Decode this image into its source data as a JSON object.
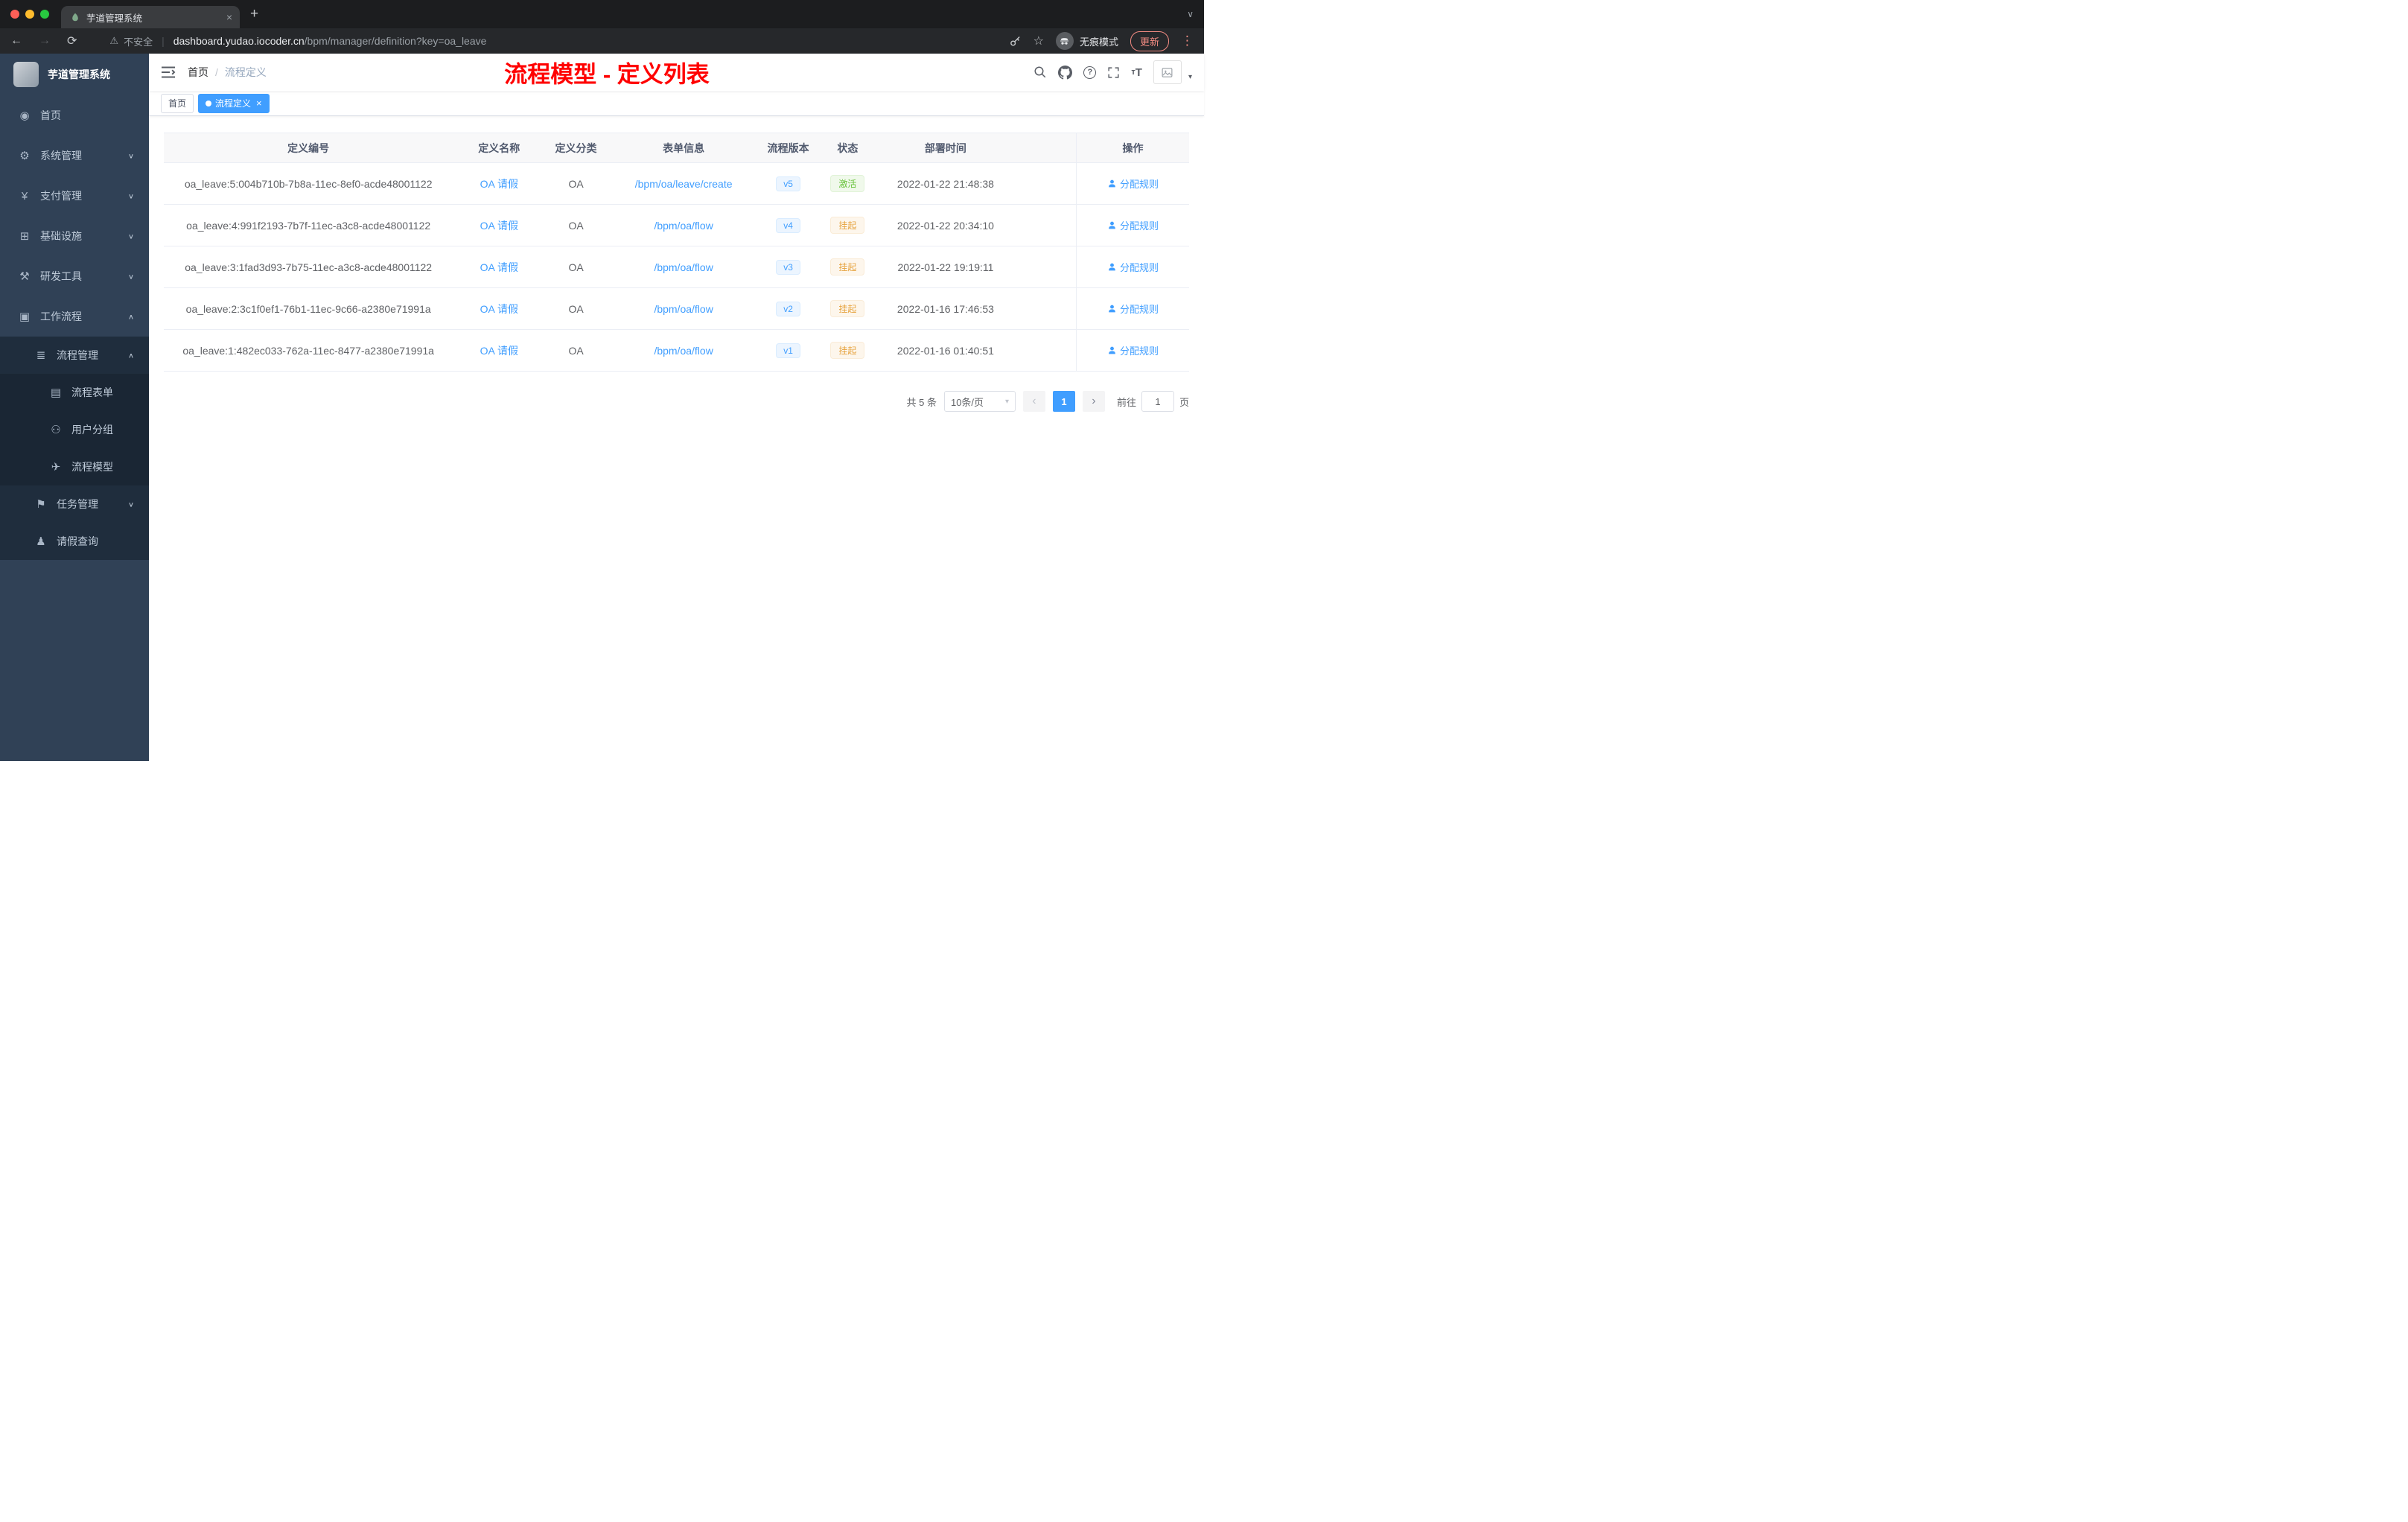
{
  "browser": {
    "tab_title": "芋道管理系统",
    "close_icon": "×",
    "new_tab_icon": "+",
    "back_icon": "←",
    "forward_icon": "→",
    "reload_icon": "⟳",
    "warning_icon": "⚠",
    "security_label": "不安全",
    "divider": "|",
    "url_domain": "dashboard.yudao.iocoder.cn",
    "url_path": "/bpm/manager/definition?key=oa_leave",
    "star_icon": "☆",
    "incognito_label": "无痕模式",
    "update_label": "更新",
    "menu_dots_icon": "⋮",
    "tab_search_icon": "∨"
  },
  "sidebar": {
    "logo_title": "芋道管理系统",
    "items": [
      {
        "key": "home",
        "label": "首页",
        "icon": "dashboard-icon",
        "level": 1
      },
      {
        "key": "system",
        "label": "系统管理",
        "icon": "gear-icon",
        "level": 1,
        "arrow": "down"
      },
      {
        "key": "payment",
        "label": "支付管理",
        "icon": "yen-icon",
        "level": 1,
        "arrow": "down"
      },
      {
        "key": "infrastructure",
        "label": "基础设施",
        "icon": "infra-icon",
        "level": 1,
        "arrow": "down"
      },
      {
        "key": "devtools",
        "label": "研发工具",
        "icon": "tools-icon",
        "level": 1,
        "arrow": "down"
      },
      {
        "key": "workflow",
        "label": "工作流程",
        "icon": "workflow-icon",
        "level": 1,
        "arrow": "up"
      },
      {
        "key": "process-mgmt",
        "label": "流程管理",
        "icon": "process-icon",
        "level": 2,
        "arrow": "up"
      },
      {
        "key": "process-form",
        "label": "流程表单",
        "icon": "form-icon",
        "level": 3
      },
      {
        "key": "user-group",
        "label": "用户分组",
        "icon": "group-icon",
        "level": 3
      },
      {
        "key": "process-model",
        "label": "流程模型",
        "icon": "model-icon",
        "level": 3
      },
      {
        "key": "task-mgmt",
        "label": "任务管理",
        "icon": "task-icon",
        "level": 2,
        "arrow": "down"
      },
      {
        "key": "leave-query",
        "label": "请假查询",
        "icon": "leave-icon",
        "level": 2
      }
    ]
  },
  "header": {
    "breadcrumb": [
      "首页",
      "流程定义"
    ],
    "breadcrumb_separator": "/",
    "annotation": "流程模型 - 定义列表"
  },
  "tags": [
    {
      "label": "首页",
      "active": false,
      "closable": false
    },
    {
      "label": "流程定义",
      "active": true,
      "closable": true
    }
  ],
  "table": {
    "columns": [
      "定义编号",
      "定义名称",
      "定义分类",
      "表单信息",
      "流程版本",
      "状态",
      "部署时间",
      "操作"
    ],
    "rows": [
      {
        "id": "oa_leave:5:004b710b-7b8a-11ec-8ef0-acde48001122",
        "name": "OA 请假",
        "category": "OA",
        "form": "/bpm/oa/leave/create",
        "version": "v5",
        "status": "激活",
        "status_type": "success",
        "deployed_at": "2022-01-22 21:48:38",
        "action": "分配规则"
      },
      {
        "id": "oa_leave:4:991f2193-7b7f-11ec-a3c8-acde48001122",
        "name": "OA 请假",
        "category": "OA",
        "form": "/bpm/oa/flow",
        "version": "v4",
        "status": "挂起",
        "status_type": "warning",
        "deployed_at": "2022-01-22 20:34:10",
        "action": "分配规则"
      },
      {
        "id": "oa_leave:3:1fad3d93-7b75-11ec-a3c8-acde48001122",
        "name": "OA 请假",
        "category": "OA",
        "form": "/bpm/oa/flow",
        "version": "v3",
        "status": "挂起",
        "status_type": "warning",
        "deployed_at": "2022-01-22 19:19:11",
        "action": "分配规则"
      },
      {
        "id": "oa_leave:2:3c1f0ef1-76b1-11ec-9c66-a2380e71991a",
        "name": "OA 请假",
        "category": "OA",
        "form": "/bpm/oa/flow",
        "version": "v2",
        "status": "挂起",
        "status_type": "warning",
        "deployed_at": "2022-01-16 17:46:53",
        "action": "分配规则"
      },
      {
        "id": "oa_leave:1:482ec033-762a-11ec-8477-a2380e71991a",
        "name": "OA 请假",
        "category": "OA",
        "form": "/bpm/oa/flow",
        "version": "v1",
        "status": "挂起",
        "status_type": "warning",
        "deployed_at": "2022-01-16 01:40:51",
        "action": "分配规则"
      }
    ]
  },
  "pagination": {
    "total": "共 5 条",
    "page_size": "10条/页",
    "prev_icon": "‹",
    "next_icon": "›",
    "current_page": "1",
    "goto_label": "前往",
    "goto_value": "1",
    "goto_unit": "页"
  },
  "colors": {
    "accent": "#409eff",
    "success": "#67c23a",
    "warning": "#e6a23c",
    "sidebar_bg": "#304156",
    "submenu_bg": "#1f2d3d",
    "annotation": "#ff0000"
  }
}
